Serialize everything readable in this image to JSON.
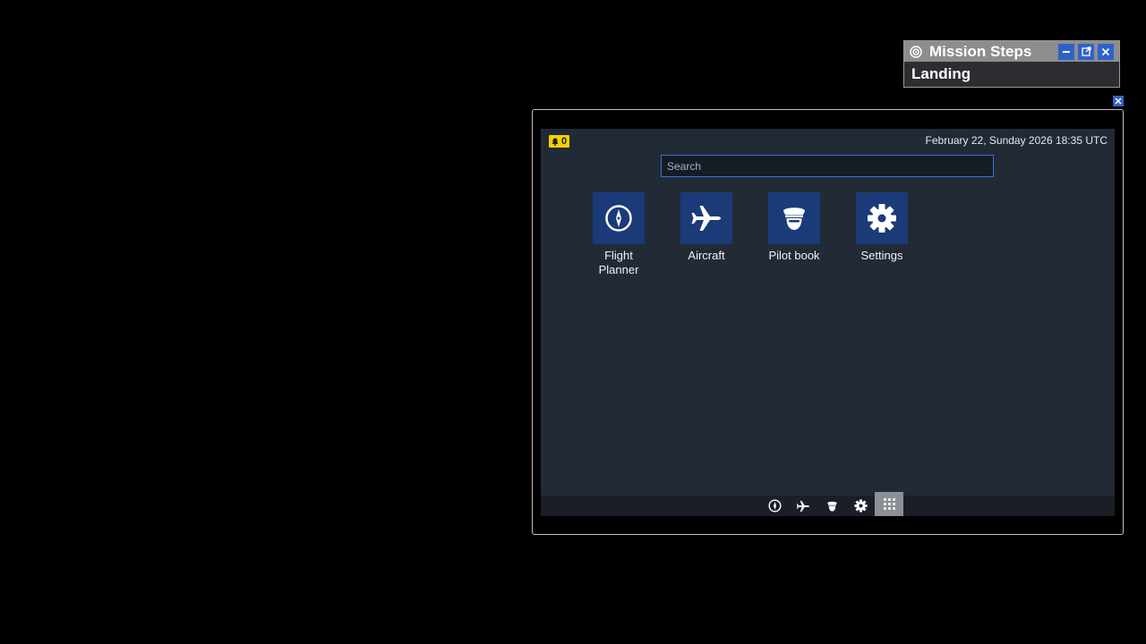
{
  "mission_panel": {
    "title": "Mission Steps",
    "step": "Landing"
  },
  "tablet": {
    "notification_count": "0",
    "datetime": "February 22, Sunday 2026 18:35 UTC",
    "search": {
      "placeholder": "Search",
      "value": ""
    },
    "apps": [
      {
        "label": "Flight\nPlanner",
        "icon": "compass-icon"
      },
      {
        "label": "Aircraft",
        "icon": "airplane-icon"
      },
      {
        "label": "Pilot book",
        "icon": "pilot-icon"
      },
      {
        "label": "Settings",
        "icon": "gear-icon"
      }
    ],
    "taskbar": [
      "compass-icon",
      "airplane-icon",
      "pilot-icon",
      "gear-icon",
      "grid-icon"
    ],
    "active_taskbar_item": "grid-icon"
  },
  "colors": {
    "accent": "#2f62c9",
    "tile": "#1b3a78",
    "screen_bg": "#222a35",
    "notification": "#f5d000"
  }
}
